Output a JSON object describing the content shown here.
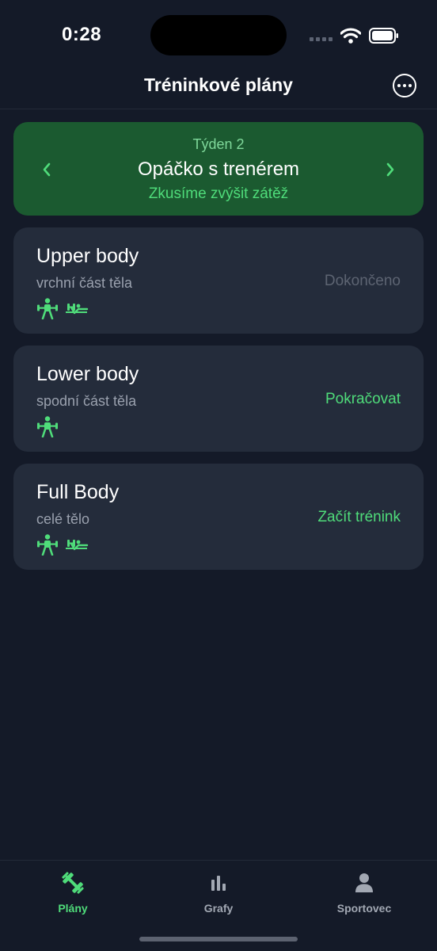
{
  "status_bar": {
    "time": "0:28"
  },
  "nav": {
    "title": "Tréninkové plány"
  },
  "week": {
    "label": "Týden 2",
    "title": "Opáčko s trenérem",
    "subtitle": "Zkusíme zvýšit zátěž"
  },
  "plans": [
    {
      "title": "Upper body",
      "subtitle": "vrchní část těla",
      "status": "Dokončeno",
      "icons": [
        "weightlifter-icon",
        "bench-press-icon"
      ]
    },
    {
      "title": "Lower body",
      "subtitle": "spodní část těla",
      "status": "Pokračovat",
      "icons": [
        "weightlifter-icon"
      ]
    },
    {
      "title": "Full Body",
      "subtitle": "celé tělo",
      "status": "Začít trénink",
      "icons": [
        "weightlifter-icon",
        "bench-press-icon"
      ]
    }
  ],
  "tabs": [
    {
      "label": "Plány",
      "icon": "dumbbell-icon",
      "active": true
    },
    {
      "label": "Grafy",
      "icon": "bar-chart-icon",
      "active": false
    },
    {
      "label": "Sportovec",
      "icon": "person-icon",
      "active": false
    }
  ],
  "colors": {
    "accent": "#4fdc7a",
    "banner": "#1b5a30",
    "card": "#242c3b",
    "background": "#141a28"
  }
}
